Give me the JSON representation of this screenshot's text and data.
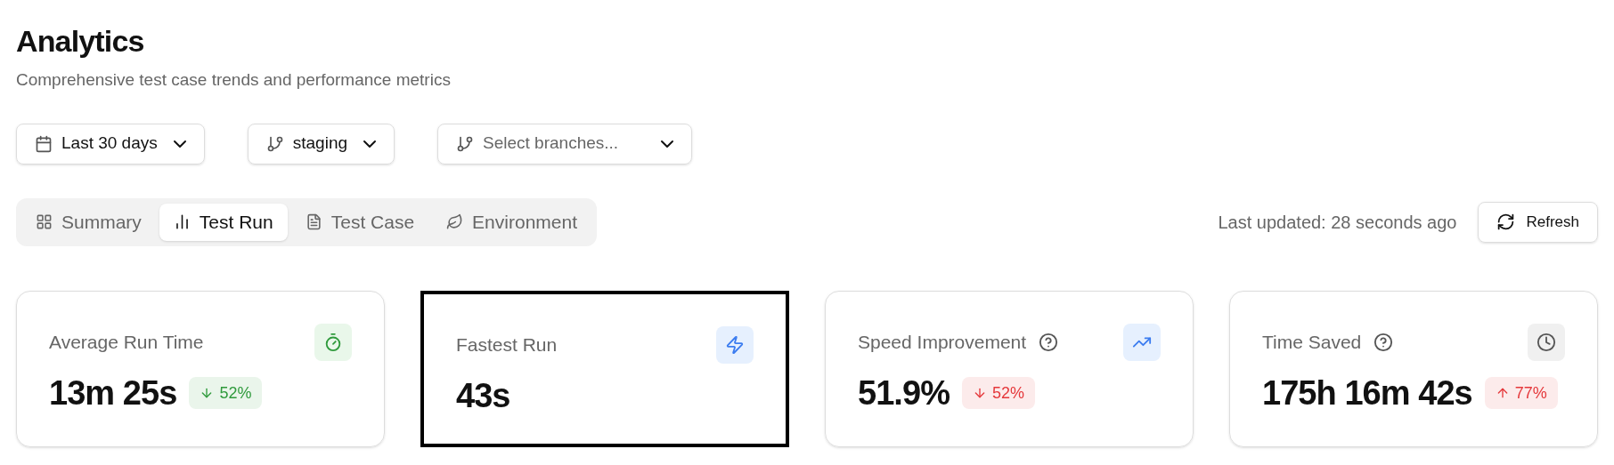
{
  "header": {
    "title": "Analytics",
    "subtitle": "Comprehensive test case trends and performance metrics"
  },
  "filters": [
    {
      "kind": "date",
      "label": "Last 30 days",
      "placeholder_style": false
    },
    {
      "kind": "branch",
      "label": "staging",
      "placeholder_style": false
    },
    {
      "kind": "branch",
      "label": "Select branches...",
      "placeholder_style": true
    }
  ],
  "tabs": [
    {
      "label": "Summary",
      "selected": false
    },
    {
      "label": "Test Run",
      "selected": true
    },
    {
      "label": "Test Case",
      "selected": false
    },
    {
      "label": "Environment",
      "selected": false
    }
  ],
  "last_updated": "Last updated: 28 seconds ago",
  "refresh_button": "Refresh",
  "cards": [
    {
      "title": "Average Run Time",
      "value": "13m 25s",
      "help": false,
      "focused": false,
      "color": "#e9f7ea",
      "badge": {
        "text": "52%",
        "rising": false,
        "color": "#2f9a3c"
      }
    },
    {
      "title": "Fastest Run",
      "value": "43s",
      "help": false,
      "focused": true,
      "color": "#e6f0fe"
    },
    {
      "title": "Speed Improvement",
      "value": "51.9%",
      "help": true,
      "focused": false,
      "color": "#e6f0fe",
      "badge": {
        "text": "52%",
        "rising": false,
        "color": "#e5383b"
      }
    },
    {
      "title": "Time Saved",
      "value": "175h 16m 42s",
      "help": true,
      "focused": false,
      "color": "#f0f0f0",
      "badge": {
        "text": "77%",
        "rising": true,
        "color": "#e5383b"
      }
    }
  ]
}
